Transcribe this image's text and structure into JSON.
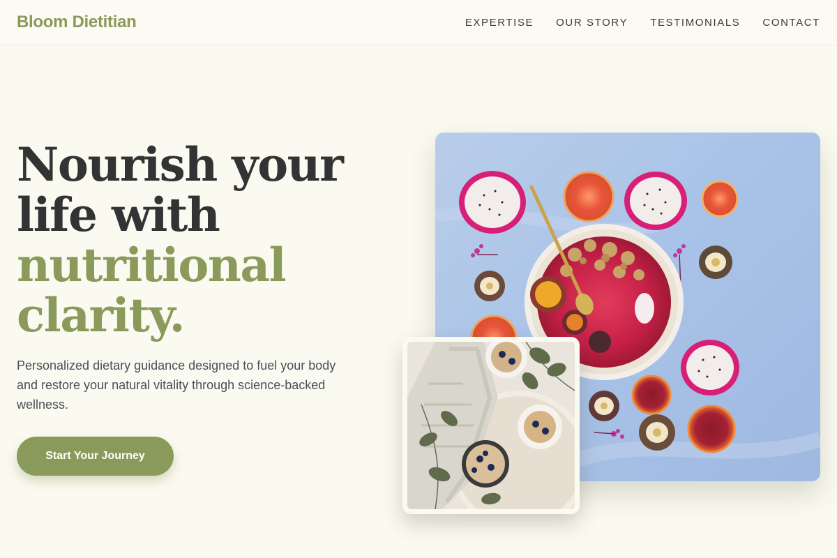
{
  "brand": {
    "name": "Bloom Dietitian"
  },
  "nav": {
    "items": [
      {
        "label": "EXPERTISE"
      },
      {
        "label": "OUR STORY"
      },
      {
        "label": "TESTIMONIALS"
      },
      {
        "label": "CONTACT"
      }
    ]
  },
  "hero": {
    "headline_line1": "Nourish your",
    "headline_line2": "life with",
    "headline_accent1": "nutritional",
    "headline_accent2": "clarity.",
    "description": "Personalized dietary guidance designed to fuel your body and restore your natural vitality through science-backed wellness.",
    "cta_label": "Start Your Journey"
  },
  "colors": {
    "accent": "#8a9a5b",
    "background": "#fbfaf1",
    "text": "#333333",
    "photo_backdrop": "#a9c3e8"
  }
}
